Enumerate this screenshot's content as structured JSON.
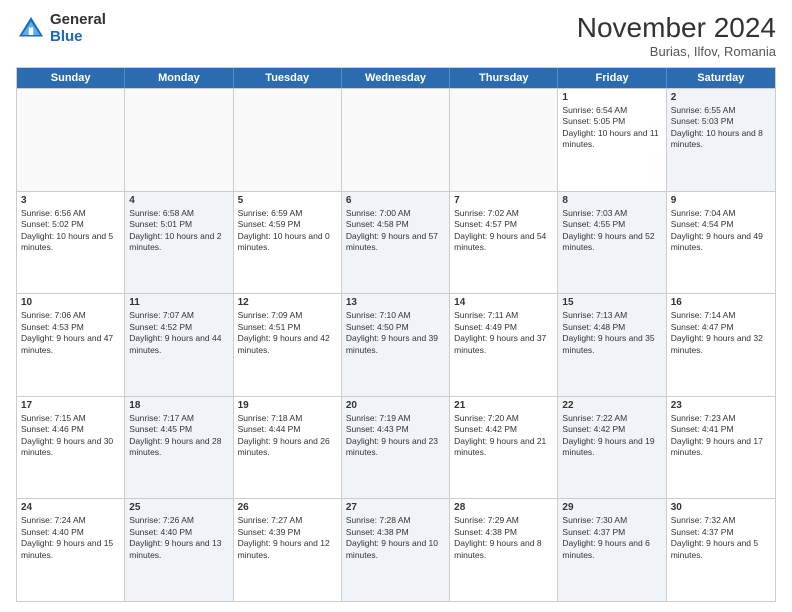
{
  "header": {
    "logo_general": "General",
    "logo_blue": "Blue",
    "month_title": "November 2024",
    "location": "Burias, Ilfov, Romania"
  },
  "weekdays": [
    "Sunday",
    "Monday",
    "Tuesday",
    "Wednesday",
    "Thursday",
    "Friday",
    "Saturday"
  ],
  "weeks": [
    [
      {
        "day": "",
        "info": "",
        "empty": true
      },
      {
        "day": "",
        "info": "",
        "empty": true
      },
      {
        "day": "",
        "info": "",
        "empty": true
      },
      {
        "day": "",
        "info": "",
        "empty": true
      },
      {
        "day": "",
        "info": "",
        "empty": true
      },
      {
        "day": "1",
        "info": "Sunrise: 6:54 AM\nSunset: 5:05 PM\nDaylight: 10 hours and 11 minutes.",
        "empty": false,
        "shaded": false
      },
      {
        "day": "2",
        "info": "Sunrise: 6:55 AM\nSunset: 5:03 PM\nDaylight: 10 hours and 8 minutes.",
        "empty": false,
        "shaded": true
      }
    ],
    [
      {
        "day": "3",
        "info": "Sunrise: 6:56 AM\nSunset: 5:02 PM\nDaylight: 10 hours and 5 minutes.",
        "empty": false,
        "shaded": false
      },
      {
        "day": "4",
        "info": "Sunrise: 6:58 AM\nSunset: 5:01 PM\nDaylight: 10 hours and 2 minutes.",
        "empty": false,
        "shaded": true
      },
      {
        "day": "5",
        "info": "Sunrise: 6:59 AM\nSunset: 4:59 PM\nDaylight: 10 hours and 0 minutes.",
        "empty": false,
        "shaded": false
      },
      {
        "day": "6",
        "info": "Sunrise: 7:00 AM\nSunset: 4:58 PM\nDaylight: 9 hours and 57 minutes.",
        "empty": false,
        "shaded": true
      },
      {
        "day": "7",
        "info": "Sunrise: 7:02 AM\nSunset: 4:57 PM\nDaylight: 9 hours and 54 minutes.",
        "empty": false,
        "shaded": false
      },
      {
        "day": "8",
        "info": "Sunrise: 7:03 AM\nSunset: 4:55 PM\nDaylight: 9 hours and 52 minutes.",
        "empty": false,
        "shaded": true
      },
      {
        "day": "9",
        "info": "Sunrise: 7:04 AM\nSunset: 4:54 PM\nDaylight: 9 hours and 49 minutes.",
        "empty": false,
        "shaded": false
      }
    ],
    [
      {
        "day": "10",
        "info": "Sunrise: 7:06 AM\nSunset: 4:53 PM\nDaylight: 9 hours and 47 minutes.",
        "empty": false,
        "shaded": false
      },
      {
        "day": "11",
        "info": "Sunrise: 7:07 AM\nSunset: 4:52 PM\nDaylight: 9 hours and 44 minutes.",
        "empty": false,
        "shaded": true
      },
      {
        "day": "12",
        "info": "Sunrise: 7:09 AM\nSunset: 4:51 PM\nDaylight: 9 hours and 42 minutes.",
        "empty": false,
        "shaded": false
      },
      {
        "day": "13",
        "info": "Sunrise: 7:10 AM\nSunset: 4:50 PM\nDaylight: 9 hours and 39 minutes.",
        "empty": false,
        "shaded": true
      },
      {
        "day": "14",
        "info": "Sunrise: 7:11 AM\nSunset: 4:49 PM\nDaylight: 9 hours and 37 minutes.",
        "empty": false,
        "shaded": false
      },
      {
        "day": "15",
        "info": "Sunrise: 7:13 AM\nSunset: 4:48 PM\nDaylight: 9 hours and 35 minutes.",
        "empty": false,
        "shaded": true
      },
      {
        "day": "16",
        "info": "Sunrise: 7:14 AM\nSunset: 4:47 PM\nDaylight: 9 hours and 32 minutes.",
        "empty": false,
        "shaded": false
      }
    ],
    [
      {
        "day": "17",
        "info": "Sunrise: 7:15 AM\nSunset: 4:46 PM\nDaylight: 9 hours and 30 minutes.",
        "empty": false,
        "shaded": false
      },
      {
        "day": "18",
        "info": "Sunrise: 7:17 AM\nSunset: 4:45 PM\nDaylight: 9 hours and 28 minutes.",
        "empty": false,
        "shaded": true
      },
      {
        "day": "19",
        "info": "Sunrise: 7:18 AM\nSunset: 4:44 PM\nDaylight: 9 hours and 26 minutes.",
        "empty": false,
        "shaded": false
      },
      {
        "day": "20",
        "info": "Sunrise: 7:19 AM\nSunset: 4:43 PM\nDaylight: 9 hours and 23 minutes.",
        "empty": false,
        "shaded": true
      },
      {
        "day": "21",
        "info": "Sunrise: 7:20 AM\nSunset: 4:42 PM\nDaylight: 9 hours and 21 minutes.",
        "empty": false,
        "shaded": false
      },
      {
        "day": "22",
        "info": "Sunrise: 7:22 AM\nSunset: 4:42 PM\nDaylight: 9 hours and 19 minutes.",
        "empty": false,
        "shaded": true
      },
      {
        "day": "23",
        "info": "Sunrise: 7:23 AM\nSunset: 4:41 PM\nDaylight: 9 hours and 17 minutes.",
        "empty": false,
        "shaded": false
      }
    ],
    [
      {
        "day": "24",
        "info": "Sunrise: 7:24 AM\nSunset: 4:40 PM\nDaylight: 9 hours and 15 minutes.",
        "empty": false,
        "shaded": false
      },
      {
        "day": "25",
        "info": "Sunrise: 7:26 AM\nSunset: 4:40 PM\nDaylight: 9 hours and 13 minutes.",
        "empty": false,
        "shaded": true
      },
      {
        "day": "26",
        "info": "Sunrise: 7:27 AM\nSunset: 4:39 PM\nDaylight: 9 hours and 12 minutes.",
        "empty": false,
        "shaded": false
      },
      {
        "day": "27",
        "info": "Sunrise: 7:28 AM\nSunset: 4:38 PM\nDaylight: 9 hours and 10 minutes.",
        "empty": false,
        "shaded": true
      },
      {
        "day": "28",
        "info": "Sunrise: 7:29 AM\nSunset: 4:38 PM\nDaylight: 9 hours and 8 minutes.",
        "empty": false,
        "shaded": false
      },
      {
        "day": "29",
        "info": "Sunrise: 7:30 AM\nSunset: 4:37 PM\nDaylight: 9 hours and 6 minutes.",
        "empty": false,
        "shaded": true
      },
      {
        "day": "30",
        "info": "Sunrise: 7:32 AM\nSunset: 4:37 PM\nDaylight: 9 hours and 5 minutes.",
        "empty": false,
        "shaded": false
      }
    ]
  ]
}
